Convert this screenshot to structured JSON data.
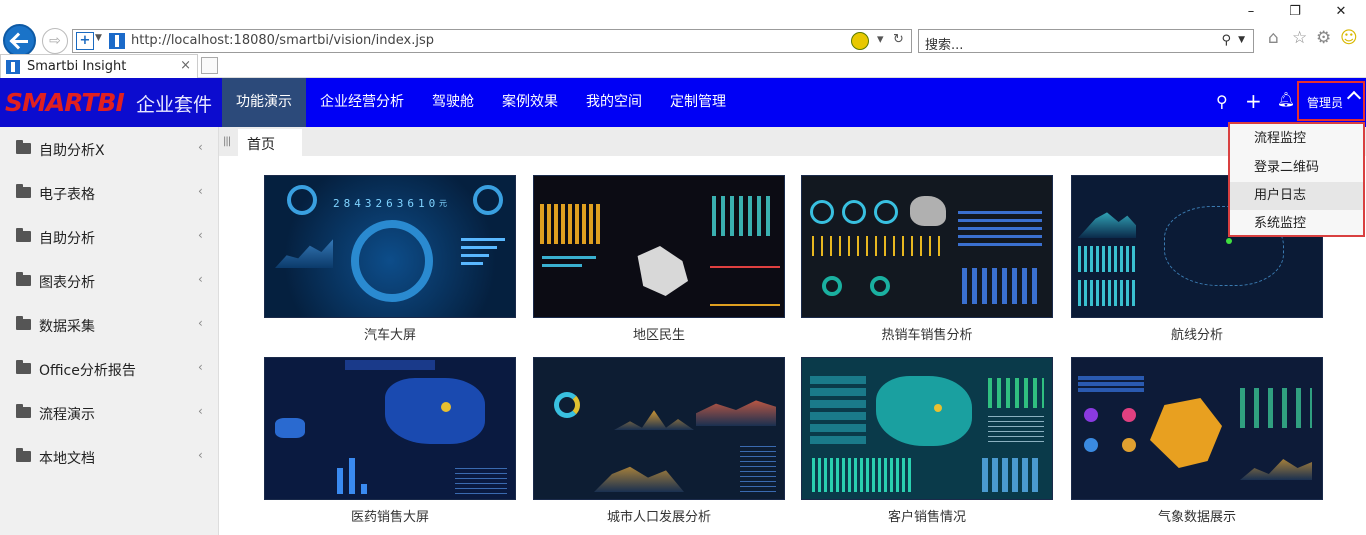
{
  "browser": {
    "url": "http://localhost:18080/smartbi/vision/index.jsp",
    "search_placeholder": "搜索...",
    "tab_title": "Smartbi Insight",
    "tab_close": "×",
    "window_buttons": [
      "–",
      "❐",
      "✕"
    ]
  },
  "header": {
    "brand": "SMARTBI",
    "suite": "企业套件",
    "nav": [
      "功能演示",
      "企业经营分析",
      "驾驶舱",
      "案例效果",
      "我的空间",
      "定制管理"
    ],
    "active_nav": 0,
    "admin_label": "管理员"
  },
  "admin_menu": [
    "流程监控",
    "登录二维码",
    "用户日志",
    "系统监控"
  ],
  "sidebar": [
    {
      "label": "自助分析X"
    },
    {
      "label": "电子表格"
    },
    {
      "label": "自助分析"
    },
    {
      "label": "图表分析"
    },
    {
      "label": "数据采集"
    },
    {
      "label": "Office分析报告"
    },
    {
      "label": "流程演示"
    },
    {
      "label": "本地文档"
    }
  ],
  "content_tab": "首页",
  "car_digits": "2843263610",
  "car_digits_unit": "元",
  "cards": [
    {
      "label": "汽车大屏",
      "theme": "t-car"
    },
    {
      "label": "地区民生",
      "theme": "t-region"
    },
    {
      "label": "热销车销售分析",
      "theme": "t-hot"
    },
    {
      "label": "航线分析",
      "theme": "t-route"
    },
    {
      "label": "医药销售大屏",
      "theme": "t-med"
    },
    {
      "label": "城市人口发展分析",
      "theme": "t-city"
    },
    {
      "label": "客户销售情况",
      "theme": "t-cust"
    },
    {
      "label": "气象数据展示",
      "theme": "t-weather"
    }
  ],
  "colors": {
    "header_bg": "#0000f5",
    "active_nav_bg": "#2c4a7a",
    "highlight_border": "#e53030"
  }
}
